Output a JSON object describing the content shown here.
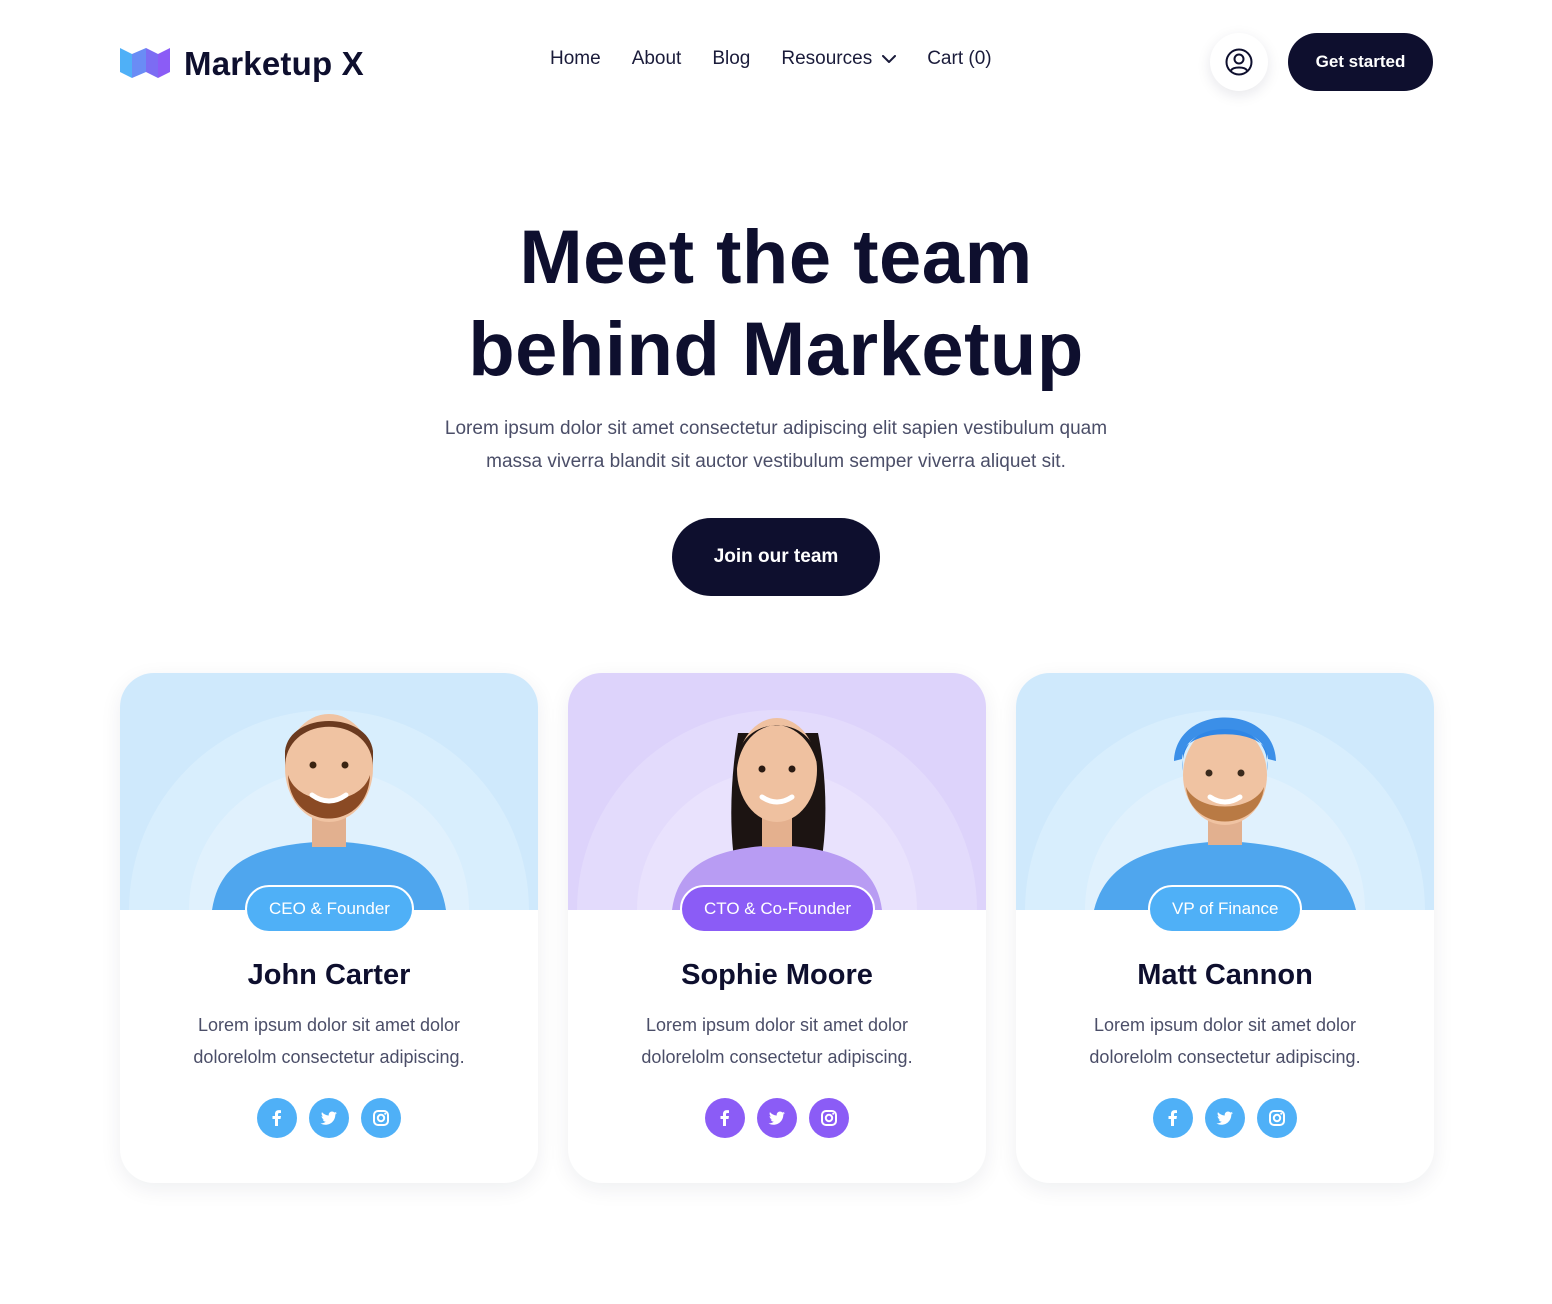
{
  "brand": {
    "name": "Marketup X",
    "logo_icon": "ribbon-logo-icon"
  },
  "nav": {
    "items": [
      {
        "label": "Home"
      },
      {
        "label": "About"
      },
      {
        "label": "Blog"
      },
      {
        "label": "Resources",
        "has_dropdown": true
      },
      {
        "label": "Cart (0)"
      }
    ]
  },
  "header": {
    "user_icon": "user-circle-icon",
    "cta_label": "Get started"
  },
  "hero": {
    "title_line1": "Meet the team",
    "title_line2": "behind Marketup",
    "subtitle_line1": "Lorem ipsum dolor sit amet consectetur adipiscing elit sapien vestibulum quam",
    "subtitle_line2": "massa viverra blandit sit auctor vestibulum semper viverra aliquet sit.",
    "cta_label": "Join our team"
  },
  "colors": {
    "navy": "#0e0f2e",
    "blue_accent": "#4fb0f7",
    "purple_accent": "#8b5cf6",
    "blue_bg": "#cfe9fc",
    "purple_bg": "#ddd3fb"
  },
  "team": [
    {
      "name": "John Carter",
      "role": "CEO & Founder",
      "desc_line1": "Lorem ipsum dolor sit amet dolor",
      "desc_line2": "dolorelolm consectetur adipiscing.",
      "theme": "blue",
      "socials": [
        "facebook-icon",
        "twitter-icon",
        "instagram-icon"
      ]
    },
    {
      "name": "Sophie Moore",
      "role": "CTO & Co-Founder",
      "desc_line1": "Lorem ipsum dolor sit amet dolor",
      "desc_line2": "dolorelolm consectetur adipiscing.",
      "theme": "purple",
      "socials": [
        "facebook-icon",
        "twitter-icon",
        "instagram-icon"
      ]
    },
    {
      "name": "Matt Cannon",
      "role": "VP of Finance",
      "desc_line1": "Lorem ipsum dolor sit amet dolor",
      "desc_line2": "dolorelolm consectetur adipiscing.",
      "theme": "blue",
      "socials": [
        "facebook-icon",
        "twitter-icon",
        "instagram-icon"
      ]
    }
  ]
}
